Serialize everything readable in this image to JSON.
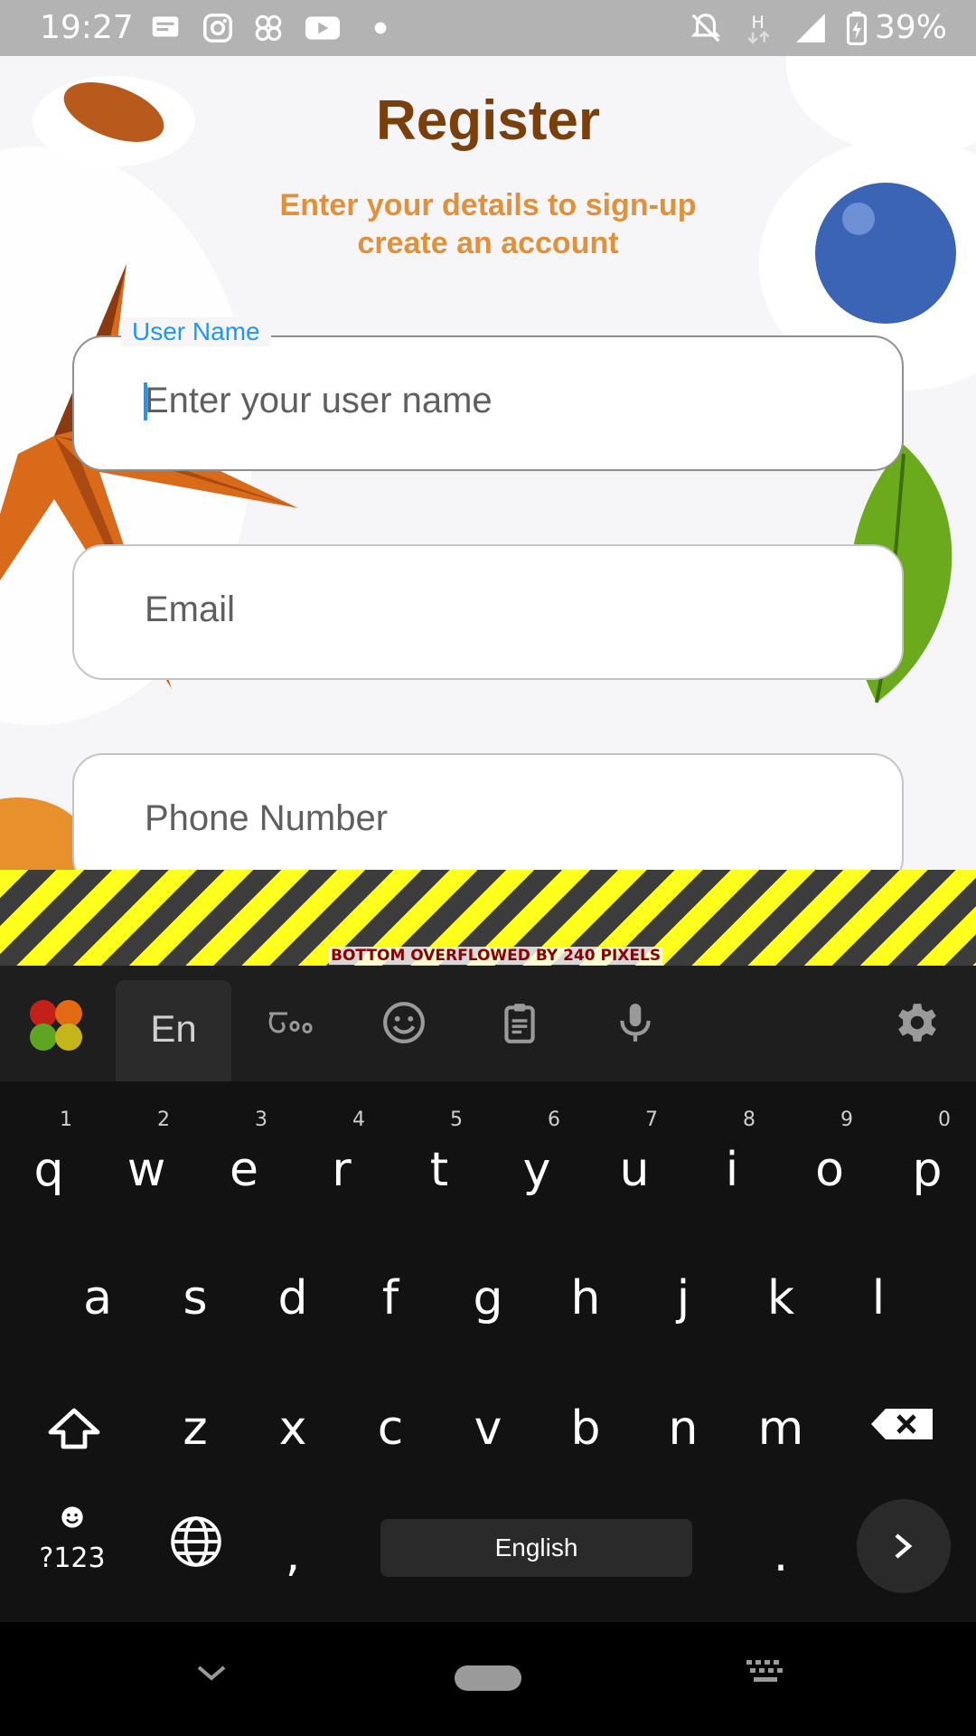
{
  "status_bar": {
    "time": "19:27",
    "battery_percent": "39%"
  },
  "screen": {
    "title": "Register",
    "subtitle_line1": "Enter your details to sign-up",
    "subtitle_line2": "create an account",
    "fields": {
      "username": {
        "label": "User Name",
        "placeholder": "Enter your user name",
        "value": ""
      },
      "email": {
        "placeholder": "Email",
        "value": ""
      },
      "phone": {
        "placeholder": "Phone Number",
        "value": ""
      }
    },
    "overflow_warning": "BOTTOM OVERFLOWED BY 240 PIXELS"
  },
  "keyboard": {
    "language_tab": "En",
    "toolbar_icons": [
      "apps-icon",
      "handwriting-icon",
      "emoji-icon",
      "clipboard-icon",
      "microphone-icon",
      "gear-icon"
    ],
    "row1": [
      {
        "ch": "q",
        "num": "1"
      },
      {
        "ch": "w",
        "num": "2"
      },
      {
        "ch": "e",
        "num": "3"
      },
      {
        "ch": "r",
        "num": "4"
      },
      {
        "ch": "t",
        "num": "5"
      },
      {
        "ch": "y",
        "num": "6"
      },
      {
        "ch": "u",
        "num": "7"
      },
      {
        "ch": "i",
        "num": "8"
      },
      {
        "ch": "o",
        "num": "9"
      },
      {
        "ch": "p",
        "num": "0"
      }
    ],
    "row2": [
      "a",
      "s",
      "d",
      "f",
      "g",
      "h",
      "j",
      "k",
      "l"
    ],
    "row3": [
      "z",
      "x",
      "c",
      "v",
      "b",
      "n",
      "m"
    ],
    "symbols_key": "?123",
    "comma": ",",
    "period": ".",
    "space_label": "English"
  },
  "colors": {
    "title": "#7a400c",
    "subtitle": "#e0913b",
    "focus_accent": "#2196f3"
  }
}
